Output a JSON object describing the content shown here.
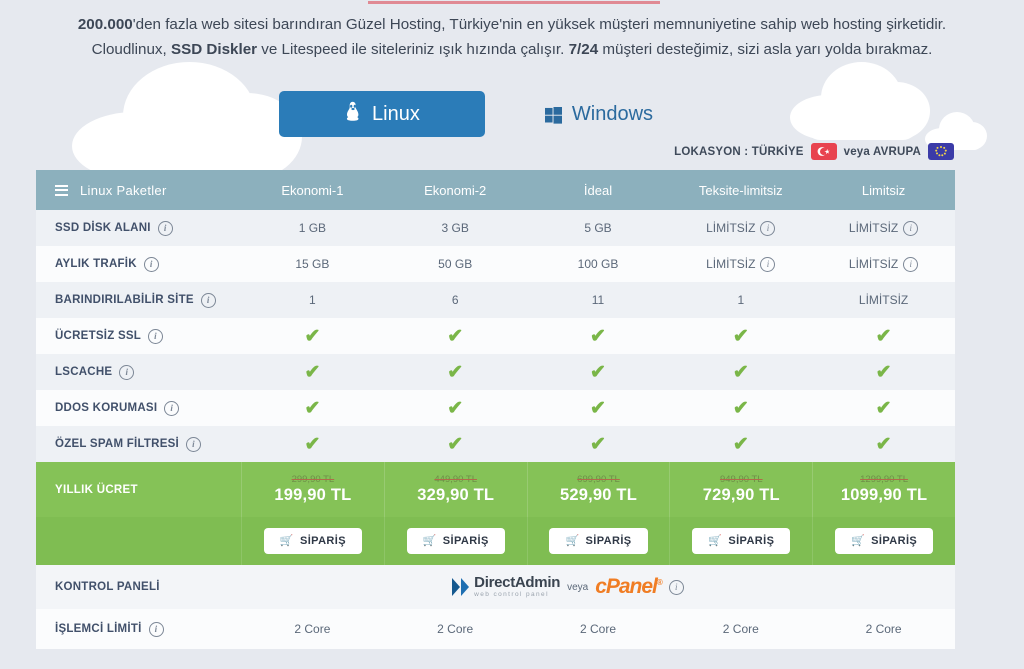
{
  "intro": {
    "line1_bold": "200.000",
    "line1_rest": "'den fazla web sitesi barındıran Güzel Hosting, Türkiye'nin en yüksek müşteri memnuniyetine sahip web hosting şirketidir.",
    "line2_a": "Cloudlinux, ",
    "line2_bold1": "SSD Diskler",
    "line2_b": " ve Litespeed ile siteleriniz ışık hızında çalışır. ",
    "line2_bold2": "7/24",
    "line2_c": " müşteri desteğimiz, sizi asla yarı yolda bırakmaz."
  },
  "tabs": {
    "linux": "Linux",
    "windows": "Windows",
    "active": "linux",
    "linux_bg": "#2b7cb8"
  },
  "location": {
    "prefix": "LOKASYON : TÜRKİYE",
    "between": "veya AVRUPA",
    "tr_color": "#e8434f",
    "eu_color": "#3b3ba8"
  },
  "table": {
    "header": {
      "label": "Linux Paketler",
      "columns": [
        "Ekonomi-1",
        "Ekonomi-2",
        "İdeal",
        "Teksite-limitsiz",
        "Limitsiz"
      ],
      "bg": "#8cb0bd"
    },
    "rows": [
      {
        "label": "SSD DİSK ALANI",
        "label_info": true,
        "values": [
          "1 GB",
          "3 GB",
          "5 GB",
          "LİMİTSİZ",
          "LİMİTSİZ"
        ],
        "value_info": [
          false,
          false,
          false,
          true,
          true
        ]
      },
      {
        "label": "AYLIK TRAFİK",
        "label_info": true,
        "values": [
          "15 GB",
          "50 GB",
          "100 GB",
          "LİMİTSİZ",
          "LİMİTSİZ"
        ],
        "value_info": [
          false,
          false,
          false,
          true,
          true
        ]
      },
      {
        "label": "BARINDIRILABİLİR SİTE",
        "label_info": true,
        "values": [
          "1",
          "6",
          "11",
          "1",
          "LİMİTSİZ"
        ],
        "value_info": [
          false,
          false,
          false,
          false,
          false
        ]
      },
      {
        "label": "ÜCRETSİZ SSL",
        "label_info": true,
        "values": [
          "check",
          "check",
          "check",
          "check",
          "check"
        ],
        "value_info": [
          false,
          false,
          false,
          false,
          false
        ]
      },
      {
        "label": "LSCACHE",
        "label_info": true,
        "values": [
          "check",
          "check",
          "check",
          "check",
          "check"
        ],
        "value_info": [
          false,
          false,
          false,
          false,
          false
        ]
      },
      {
        "label": "DDOS KORUMASI",
        "label_info": true,
        "values": [
          "check",
          "check",
          "check",
          "check",
          "check"
        ],
        "value_info": [
          false,
          false,
          false,
          false,
          false
        ]
      },
      {
        "label": "ÖZEL SPAM FİLTRESİ",
        "label_info": true,
        "values": [
          "check",
          "check",
          "check",
          "check",
          "check"
        ],
        "value_info": [
          false,
          false,
          false,
          false,
          false
        ]
      }
    ],
    "price": {
      "label": "YILLIK ÜCRET",
      "bg": "#85c257",
      "old": [
        "299,90 TL",
        "449,90 TL",
        "699,90 TL",
        "949,90 TL",
        "1299,90 TL"
      ],
      "new": [
        "199,90 TL",
        "329,90 TL",
        "529,90 TL",
        "729,90 TL",
        "1099,90 TL"
      ]
    },
    "order": {
      "label": "SİPARİŞ",
      "icon": "cart-icon"
    },
    "control_panel": {
      "label": "KONTROL PANELİ",
      "directadmin": "DirectAdmin",
      "directadmin_sub": "web control panel",
      "veya": "veya",
      "cpanel": "cPanel",
      "cpanel_mark": "®",
      "info": true
    },
    "cpu": {
      "label": "İŞLEMCİ LİMİTİ",
      "label_info": true,
      "values": [
        "2 Core",
        "2 Core",
        "2 Core",
        "2 Core",
        "2 Core"
      ]
    }
  }
}
